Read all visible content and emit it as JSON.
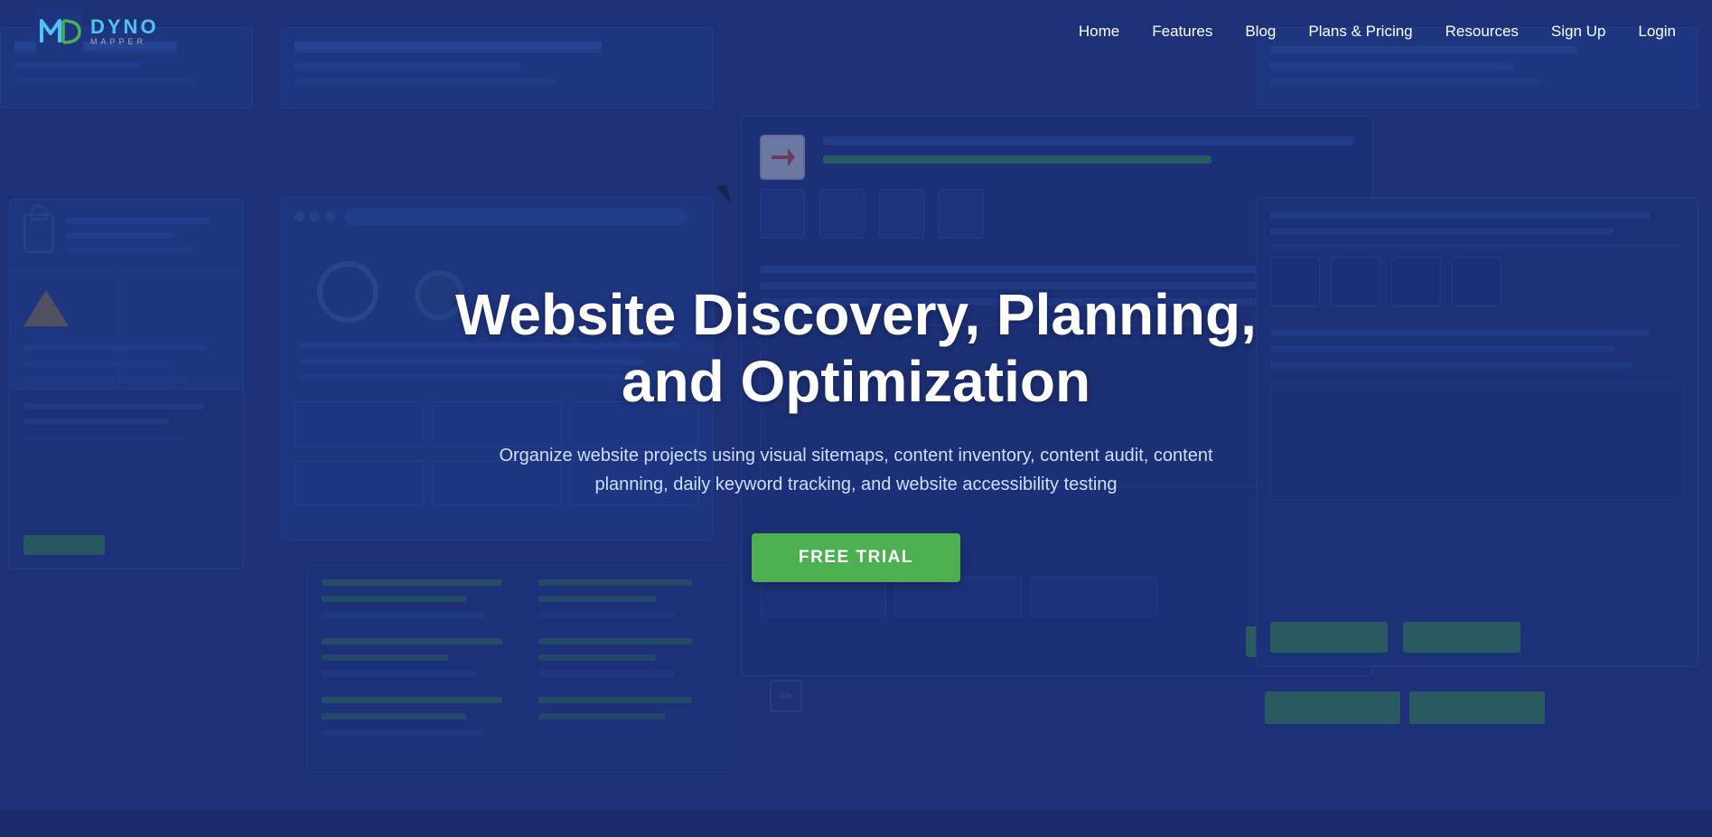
{
  "meta": {
    "title": "Dyno Mapper - Website Discovery, Planning, and Optimization"
  },
  "nav": {
    "logo_alt": "Dyno Mapper",
    "links": [
      {
        "label": "Home",
        "href": "#"
      },
      {
        "label": "Features",
        "href": "#"
      },
      {
        "label": "Blog",
        "href": "#"
      },
      {
        "label": "Plans & Pricing",
        "href": "#"
      },
      {
        "label": "Resources",
        "href": "#"
      },
      {
        "label": "Sign Up",
        "href": "#"
      },
      {
        "label": "Login",
        "href": "#"
      }
    ]
  },
  "hero": {
    "title": "Website Discovery, Planning, and Optimization",
    "subtitle": "Organize website projects using visual sitemaps, content inventory, content audit, content planning, daily keyword tracking, and website accessibility testing",
    "cta_label": "FREE TRIAL"
  },
  "colors": {
    "bg_dark": "#1e3178",
    "bg_mid": "#1a2f7a",
    "green": "#4caf50",
    "green_dark": "#3d9c3d",
    "accent_blue": "#2e5cb8",
    "white": "#ffffff"
  }
}
